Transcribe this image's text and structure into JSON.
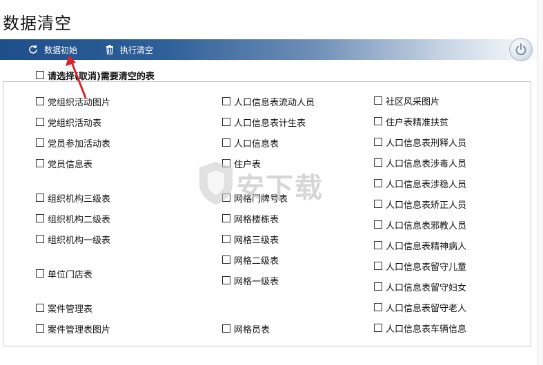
{
  "page": {
    "title": "数据清空"
  },
  "toolbar": {
    "init_label": "数据初始",
    "clear_label": "执行清空"
  },
  "select_all": {
    "label": "请选择(取消)需要清空的表"
  },
  "tables": {
    "col1": [
      "党组织活动图片",
      "党组织活动表",
      "党员参加活动表",
      "党员信息表",
      "组织机构三级表",
      "组织机构二级表",
      "组织机构一级表",
      "单位门店表",
      "案件管理表",
      "案件管理表图片"
    ],
    "col2": [
      "人口信息表流动人员",
      "人口信息表计生表",
      "人口信息表",
      "住户表",
      "网格门牌号表",
      "网格楼栋表",
      "网格三级表",
      "网格二级表",
      "网格一级表",
      "网格员表"
    ],
    "col3": [
      "社区风采图片",
      "住户表精准扶贫",
      "人口信息表刑释人员",
      "人口信息表涉毒人员",
      "人口信息表涉稳人员",
      "人口信息表矫正人员",
      "人口信息表邪教人员",
      "人口信息表精神病人",
      "人口信息表留守儿童",
      "人口信息表留守妇女",
      "人口信息表留守老人",
      "人口信息表车辆信息"
    ]
  },
  "watermark": {
    "text": "安下载"
  },
  "colors": {
    "toolbar_start": "#1f4f8b",
    "arrow": "#d7262b"
  }
}
